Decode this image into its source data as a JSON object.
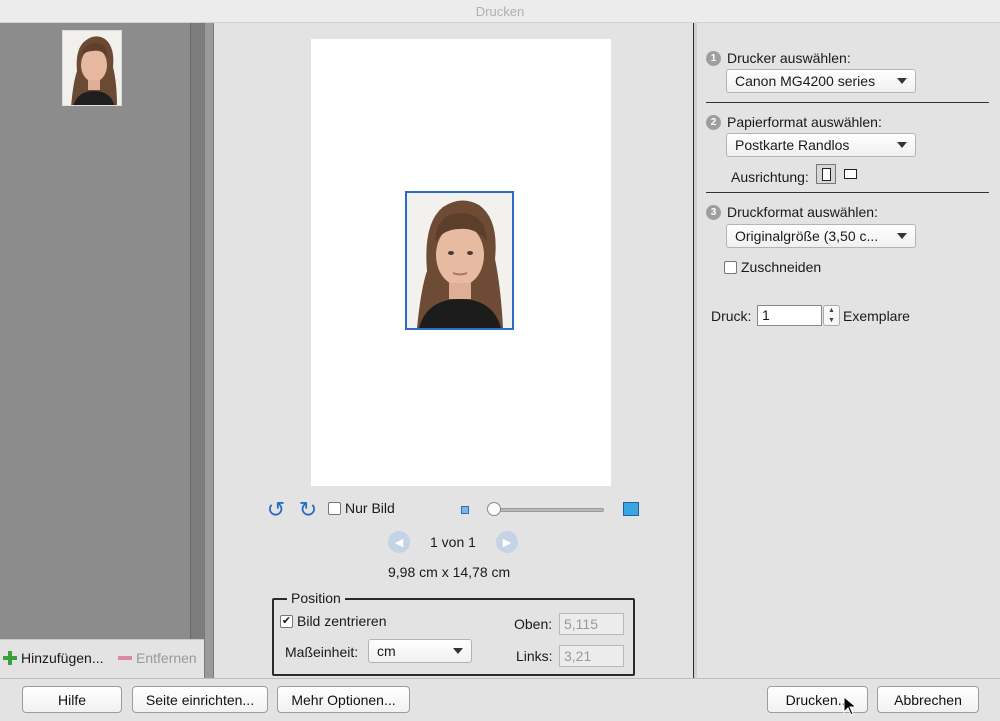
{
  "window": {
    "title": "Drucken"
  },
  "left": {
    "add_label": "Hinzufügen...",
    "remove_label": "Entfernen"
  },
  "preview": {
    "only_image_label": "Nur Bild",
    "page_indicator": "1 von 1",
    "dimensions": "9,98 cm x 14,78 cm"
  },
  "position": {
    "legend": "Position",
    "center_label": "Bild zentrieren",
    "unit_label": "Maßeinheit:",
    "unit_value": "cm",
    "top_label": "Oben:",
    "top_value": "5,115",
    "left_label": "Links:",
    "left_value": "3,21"
  },
  "settings": {
    "step1": {
      "num": "1",
      "label": "Drucker auswählen:",
      "value": "Canon MG4200 series"
    },
    "step2": {
      "num": "2",
      "label": "Papierformat auswählen:",
      "value": "Postkarte Randlos",
      "orientation_label": "Ausrichtung:"
    },
    "step3": {
      "num": "3",
      "label": "Druckformat auswählen:",
      "value": "Originalgröße (3,50 c...",
      "crop_label": "Zuschneiden"
    },
    "copies": {
      "prefix": "Druck:",
      "value": "1",
      "suffix": "Exemplare"
    }
  },
  "buttons": {
    "help": "Hilfe",
    "page_setup": "Seite einrichten...",
    "more_options": "Mehr Optionen...",
    "print": "Drucken...",
    "cancel": "Abbrechen"
  },
  "colors": {
    "selection_border": "#2b6cc4",
    "add_icon": "#3aa13a",
    "remove_icon": "#d98aa0"
  }
}
